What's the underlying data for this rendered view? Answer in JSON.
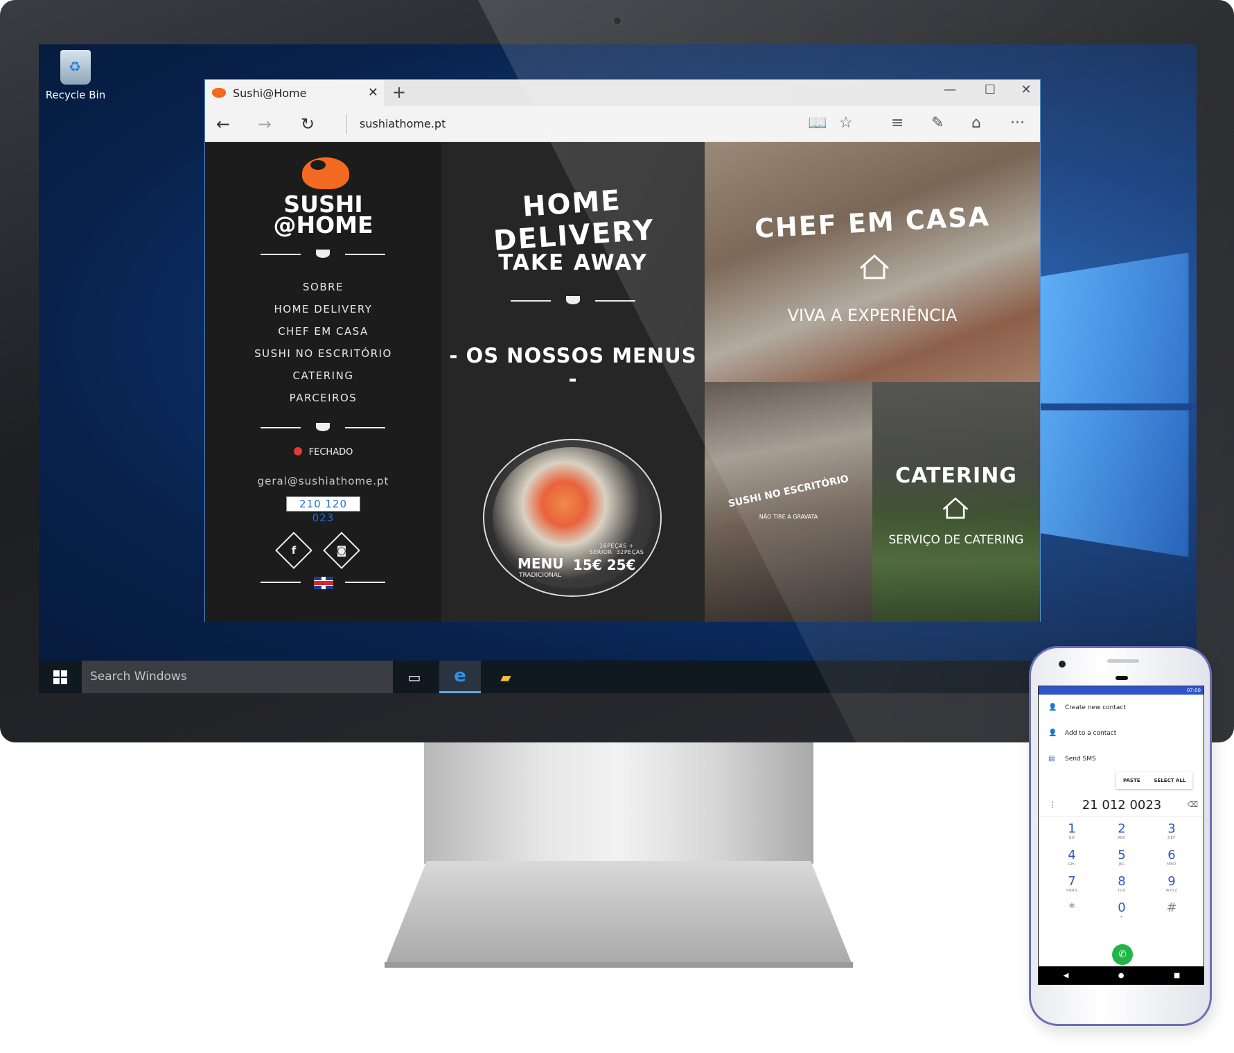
{
  "desktop": {
    "recycle_bin_label": "Recycle Bin",
    "taskbar": {
      "search_placeholder": "Search Windows",
      "icons": [
        "start-icon",
        "task-view-icon",
        "edge-icon",
        "file-explorer-icon"
      ]
    }
  },
  "browser": {
    "tab_title": "Sushi@Home",
    "tab_close": "✕",
    "new_tab": "+",
    "window_controls": {
      "minimize": "—",
      "maximize": "☐",
      "close": "✕"
    },
    "nav": {
      "back": "←",
      "forward": "→",
      "refresh": "↻"
    },
    "url": "sushiathome.pt",
    "tools": {
      "reading_view": "📖",
      "favorite": "☆",
      "hub": "≡",
      "web_note": "✎",
      "share": "⌂",
      "more": "···"
    }
  },
  "site": {
    "logo_line1": "SUSHI",
    "logo_line2": "@HOME",
    "nav_items": [
      "SOBRE",
      "HOME DELIVERY",
      "CHEF EM CASA",
      "SUSHI NO ESCRITÓRIO",
      "CATERING",
      "PARCEIROS"
    ],
    "status": "FECHADO",
    "email": "geral@sushiathome.pt",
    "phone": "210 120 023",
    "social": {
      "facebook": "f",
      "instagram": "◙"
    },
    "headline_delivery": "HOME DELIVERY",
    "headline_takeaway": "TAKE AWAY",
    "menus_heading": "- OS NOSSOS MENUS -",
    "menu_card": {
      "title": "MENU",
      "subtitle": "TRADICIONAL",
      "option1_label": "16PEÇAS + SERIOR",
      "option2_label": "32PEÇAS",
      "price1": "15€",
      "price2": "25€"
    },
    "tiles": {
      "chef": {
        "title": "CHEF EM CASA",
        "subtitle": "VIVA A EXPERIÊNCIA"
      },
      "office": {
        "title": "SUSHI NO ESCRITÓRIO",
        "subtitle": "NÃO TIRE A GRAVATA"
      },
      "catering": {
        "title": "CATERING",
        "subtitle": "SERVIÇO DE CATERING"
      }
    }
  },
  "phone": {
    "status_time": "07:00",
    "menu_items": [
      "Create new contact",
      "Add to a contact",
      "Send SMS"
    ],
    "actions": [
      "PASTE",
      "SELECT ALL"
    ],
    "number": "21 012 0023",
    "keys": [
      {
        "d": "1",
        "s": "QD"
      },
      {
        "d": "2",
        "s": "ABC"
      },
      {
        "d": "3",
        "s": "DEF"
      },
      {
        "d": "4",
        "s": "GHI"
      },
      {
        "d": "5",
        "s": "JKL"
      },
      {
        "d": "6",
        "s": "MNO"
      },
      {
        "d": "7",
        "s": "PQRS"
      },
      {
        "d": "8",
        "s": "TUV"
      },
      {
        "d": "9",
        "s": "WXYZ"
      },
      {
        "d": "*",
        "s": ""
      },
      {
        "d": "0",
        "s": "+"
      },
      {
        "d": "#",
        "s": ""
      }
    ],
    "nav": {
      "back": "◀",
      "home": "●",
      "recents": "■"
    }
  }
}
